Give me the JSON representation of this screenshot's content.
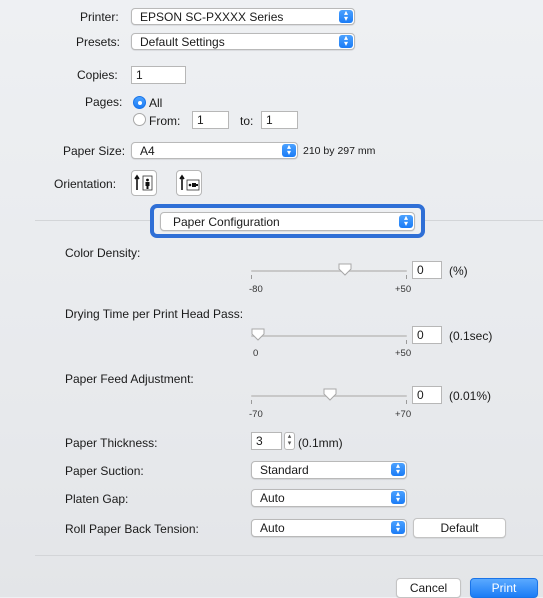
{
  "printer": {
    "label": "Printer:",
    "value": "EPSON SC-PXXXX Series"
  },
  "presets": {
    "label": "Presets:",
    "value": "Default Settings"
  },
  "copies": {
    "label": "Copies:",
    "value": "1"
  },
  "pages": {
    "label": "Pages:",
    "all_label": "All",
    "from_label": "From:",
    "from_value": "1",
    "to_label": "to:",
    "to_value": "1",
    "selected": "All"
  },
  "paper_size": {
    "label": "Paper Size:",
    "value": "A4",
    "dimensions": "210 by 297 mm"
  },
  "orientation": {
    "label": "Orientation:",
    "selected": "portrait"
  },
  "panel_selector": {
    "value": "Paper Configuration"
  },
  "color_density": {
    "label": "Color Density:",
    "value": "0",
    "unit": "(%)",
    "min_label": "-80",
    "max_label": "+50",
    "min": -80,
    "max": 50,
    "current": 0
  },
  "drying_time": {
    "label": "Drying Time per Print Head Pass:",
    "value": "0",
    "unit": "(0.1sec)",
    "min_label": "0",
    "max_label": "+50",
    "min": 0,
    "max": 50,
    "current": 0
  },
  "paper_feed": {
    "label": "Paper Feed Adjustment:",
    "value": "0",
    "unit": "(0.01%)",
    "min_label": "-70",
    "max_label": "+70",
    "min": -70,
    "max": 70,
    "current": 0
  },
  "paper_thickness": {
    "label": "Paper Thickness:",
    "value": "3",
    "unit": "(0.1mm)"
  },
  "paper_suction": {
    "label": "Paper Suction:",
    "value": "Standard"
  },
  "platen_gap": {
    "label": "Platen Gap:",
    "value": "Auto"
  },
  "roll_tension": {
    "label": "Roll Paper Back Tension:",
    "value": "Auto",
    "default_button": "Default"
  },
  "buttons": {
    "cancel": "Cancel",
    "print": "Print"
  },
  "colors": {
    "accent": "#1b7cf6",
    "focus_ring": "#2f6fd6"
  }
}
